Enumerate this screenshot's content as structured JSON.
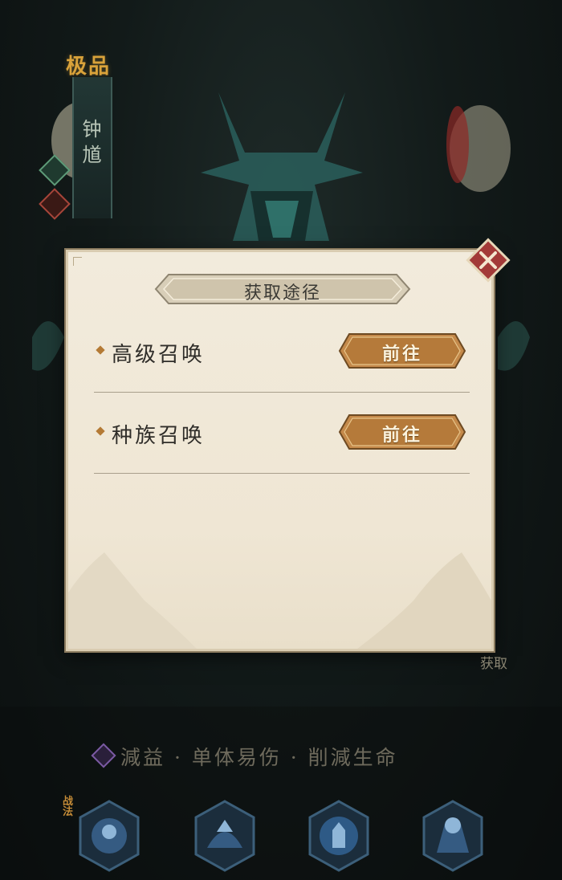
{
  "hero": {
    "rank_label": "极品",
    "name": "钟馗"
  },
  "dialog": {
    "title": "获取途径",
    "close_icon": "close-icon",
    "sources": [
      {
        "label": "高级召唤",
        "button": "前往"
      },
      {
        "label": "种族召唤",
        "button": "前往"
      }
    ]
  },
  "side_label": "获取",
  "traits": "減益 · 单体易伤 · 削減生命",
  "skills": {
    "badge": "战法",
    "icons": [
      "skill-1-icon",
      "skill-2-icon",
      "skill-3-icon",
      "skill-4-icon"
    ]
  },
  "colors": {
    "gold": "#d9a23a",
    "parchment": "#efe6d4",
    "button": "#c48a3a",
    "close": "#a33a38"
  }
}
